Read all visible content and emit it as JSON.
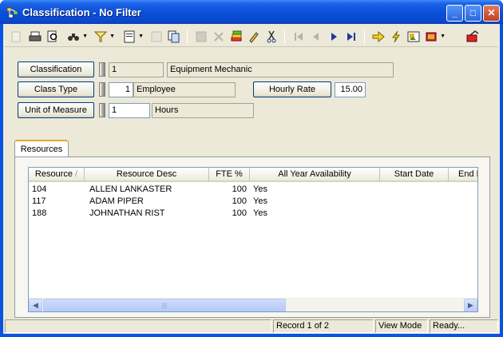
{
  "window": {
    "title": "Classification - No Filter",
    "controls": {
      "minimize": "_",
      "maximize": "□",
      "close": "✕"
    }
  },
  "toolbar": {
    "icons": [
      "new-record-icon",
      "print-icon",
      "print-preview-icon",
      "find-icon",
      "filter-icon",
      "form-view-icon",
      "properties-icon",
      "copy-icon",
      "save-icon",
      "delete-icon",
      "stack-icon",
      "edit-pencil-icon",
      "cut-icon",
      "first-record-icon",
      "previous-record-icon",
      "next-record-icon",
      "last-record-icon",
      "go-to-icon",
      "lightning-icon",
      "image-icon",
      "book-icon",
      "exit-icon"
    ]
  },
  "form": {
    "classification": {
      "label": "Classification",
      "id": "1",
      "name": "Equipment Mechanic"
    },
    "class_type": {
      "label": "Class Type",
      "id": "1",
      "name": "Employee"
    },
    "hourly_rate": {
      "label": "Hourly Rate",
      "value": "15.00"
    },
    "unit_of_measure": {
      "label": "Unit of Measure",
      "id": "1",
      "name": "Hours"
    }
  },
  "tabs": [
    {
      "label": "Resources",
      "active": true
    }
  ],
  "grid": {
    "columns": [
      "Resource",
      "Resource Desc",
      "FTE %",
      "All Year Availability",
      "Start Date",
      "End D"
    ],
    "sort_indicator": "/",
    "rows": [
      {
        "resource": "104",
        "desc": "ALLEN LANKASTER",
        "fte": "100",
        "availability": "Yes"
      },
      {
        "resource": "117",
        "desc": "ADAM PIPER",
        "fte": "100",
        "availability": "Yes"
      },
      {
        "resource": "188",
        "desc": "JOHNATHAN RIST",
        "fte": "100",
        "availability": "Yes"
      }
    ],
    "scroll_grip": "|||"
  },
  "status": {
    "record": "Record 1 of 2",
    "mode": "View Mode",
    "state": "Ready..."
  },
  "colors": {
    "title_bar": "#0a4fd8",
    "face": "#ece9d8",
    "accent_tab": "#e8a838"
  }
}
